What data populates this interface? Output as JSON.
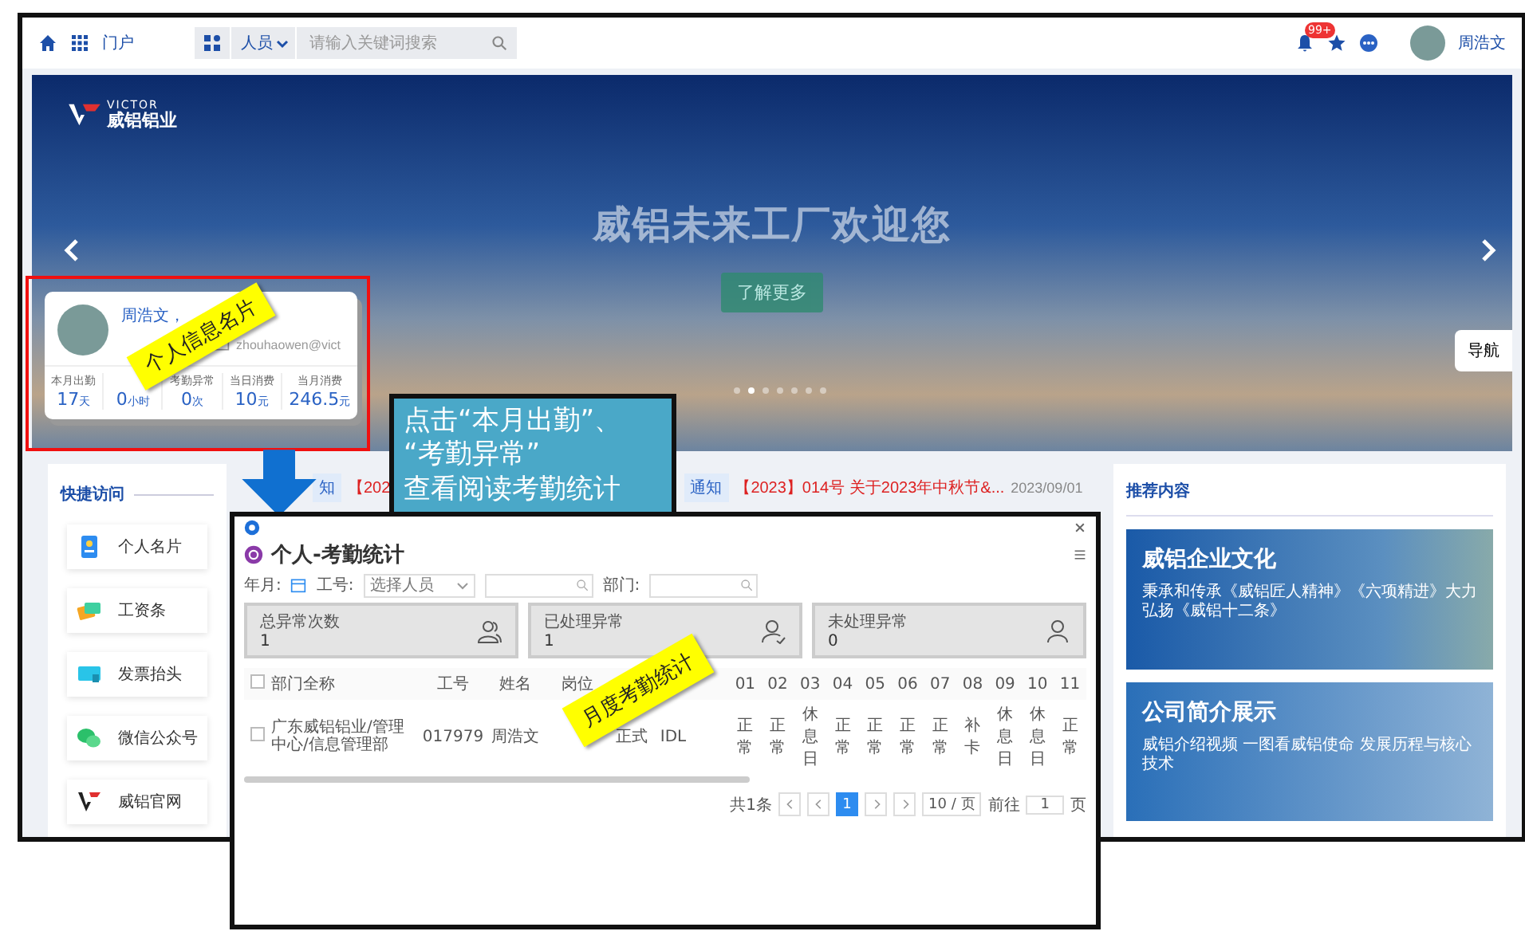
{
  "topbar": {
    "menu_label": "门户",
    "search_scope": "人员",
    "search": {
      "placeholder": "请输入关键词搜索"
    },
    "notification_badge": "99+",
    "user_name": "周浩文"
  },
  "banner": {
    "logo_brand": "VICTOR",
    "logo_name": "威铝铝业",
    "title": "威铝未来工厂欢迎您",
    "button": "了解更多",
    "nav_button": "导航",
    "slides": [
      {
        "selected": false
      },
      {
        "selected": true
      },
      {
        "selected": false
      },
      {
        "selected": false
      },
      {
        "selected": false
      },
      {
        "selected": false
      },
      {
        "selected": false
      }
    ]
  },
  "profile_card": {
    "name": "周浩文，",
    "email": "zhouhaowen@vict",
    "stats": [
      {
        "label": "本月出勤",
        "value": "17",
        "unit": "天"
      },
      {
        "value": "0",
        "unit": "小时"
      },
      {
        "label": "考勤异常",
        "value": "0",
        "unit": "次"
      },
      {
        "label": "当日消费",
        "value": "10",
        "unit": "元"
      },
      {
        "label": "当月消费",
        "value": "246.5",
        "unit": "元"
      }
    ]
  },
  "annotations": {
    "profile_note": "个人信息名片",
    "callout_lines": [
      "点击“本月出勤”、",
      "“考勤异常”",
      "查看阅读考勤统计"
    ],
    "monthly_note": "月度考勤统计"
  },
  "quick_access": {
    "title": "快捷访问",
    "items": [
      {
        "label": "个人名片",
        "kind": "card"
      },
      {
        "label": "工资条",
        "kind": "money"
      },
      {
        "label": "发票抬头",
        "kind": "screen"
      },
      {
        "label": "微信公众号",
        "kind": "chat"
      },
      {
        "label": "威铝官网",
        "kind": "logo"
      }
    ]
  },
  "notices": [
    {
      "tag": "知",
      "title": "【202"
    },
    {
      "tag": "通知",
      "title": "【2023】014号 关于2023年中秋节&...",
      "date": "2023/09/01"
    }
  ],
  "recommended": {
    "title": "推荐内容",
    "cards": [
      {
        "title": "威铝企业文化",
        "subtitle": "秉承和传承《威铝匠人精神》《六项精进》大力弘扬《威铝十二条》"
      },
      {
        "title": "公司简介展示",
        "subtitle": "威铝介绍视频 一图看威铝使命 发展历程与核心技术"
      }
    ]
  },
  "attendance_window": {
    "title": "个人-考勤统计",
    "filters": [
      {
        "label": "年月:",
        "kind": "date"
      },
      {
        "label": "工号:",
        "kind": "select",
        "placeholder": "选择人员"
      },
      {
        "label": "部门:",
        "kind": "input"
      }
    ],
    "stats": [
      {
        "label": "总异常次数",
        "value": "1",
        "kind": "group"
      },
      {
        "label": "已处理异常",
        "value": "1",
        "kind": "done"
      },
      {
        "label": "未处理异常",
        "value": "0",
        "kind": "user"
      }
    ],
    "table": {
      "all_selected": false,
      "columns": [
        {
          "label": "部门全称"
        },
        {
          "label": "工号"
        },
        {
          "label": "姓名"
        },
        {
          "label": "岗位"
        },
        {},
        {},
        {},
        {
          "label": "01"
        },
        {
          "label": "02"
        },
        {
          "label": "03"
        },
        {
          "label": "04"
        },
        {
          "label": "05"
        },
        {
          "label": "06"
        },
        {
          "label": "07"
        },
        {
          "label": "08"
        },
        {
          "label": "09"
        },
        {
          "label": "10"
        },
        {
          "label": "11"
        }
      ],
      "rows": [
        {
          "selected": false,
          "cells": [
            "广东威铝铝业/管理中心/信息管理部",
            "017979",
            "周浩文",
            null,
            "正式",
            "IDL",
            null,
            "正常",
            "正常",
            "休息日",
            "正常",
            "正常",
            "正常",
            "正常",
            "补卡",
            "休息日",
            "休息日",
            "正常"
          ]
        }
      ]
    },
    "pagination": {
      "total": "共1条",
      "pages": [
        {
          "label": "1",
          "selected": true
        }
      ],
      "page_size": "10 / 页",
      "goto_label": "前往",
      "goto_value": "1",
      "page_suffix": "页"
    }
  }
}
